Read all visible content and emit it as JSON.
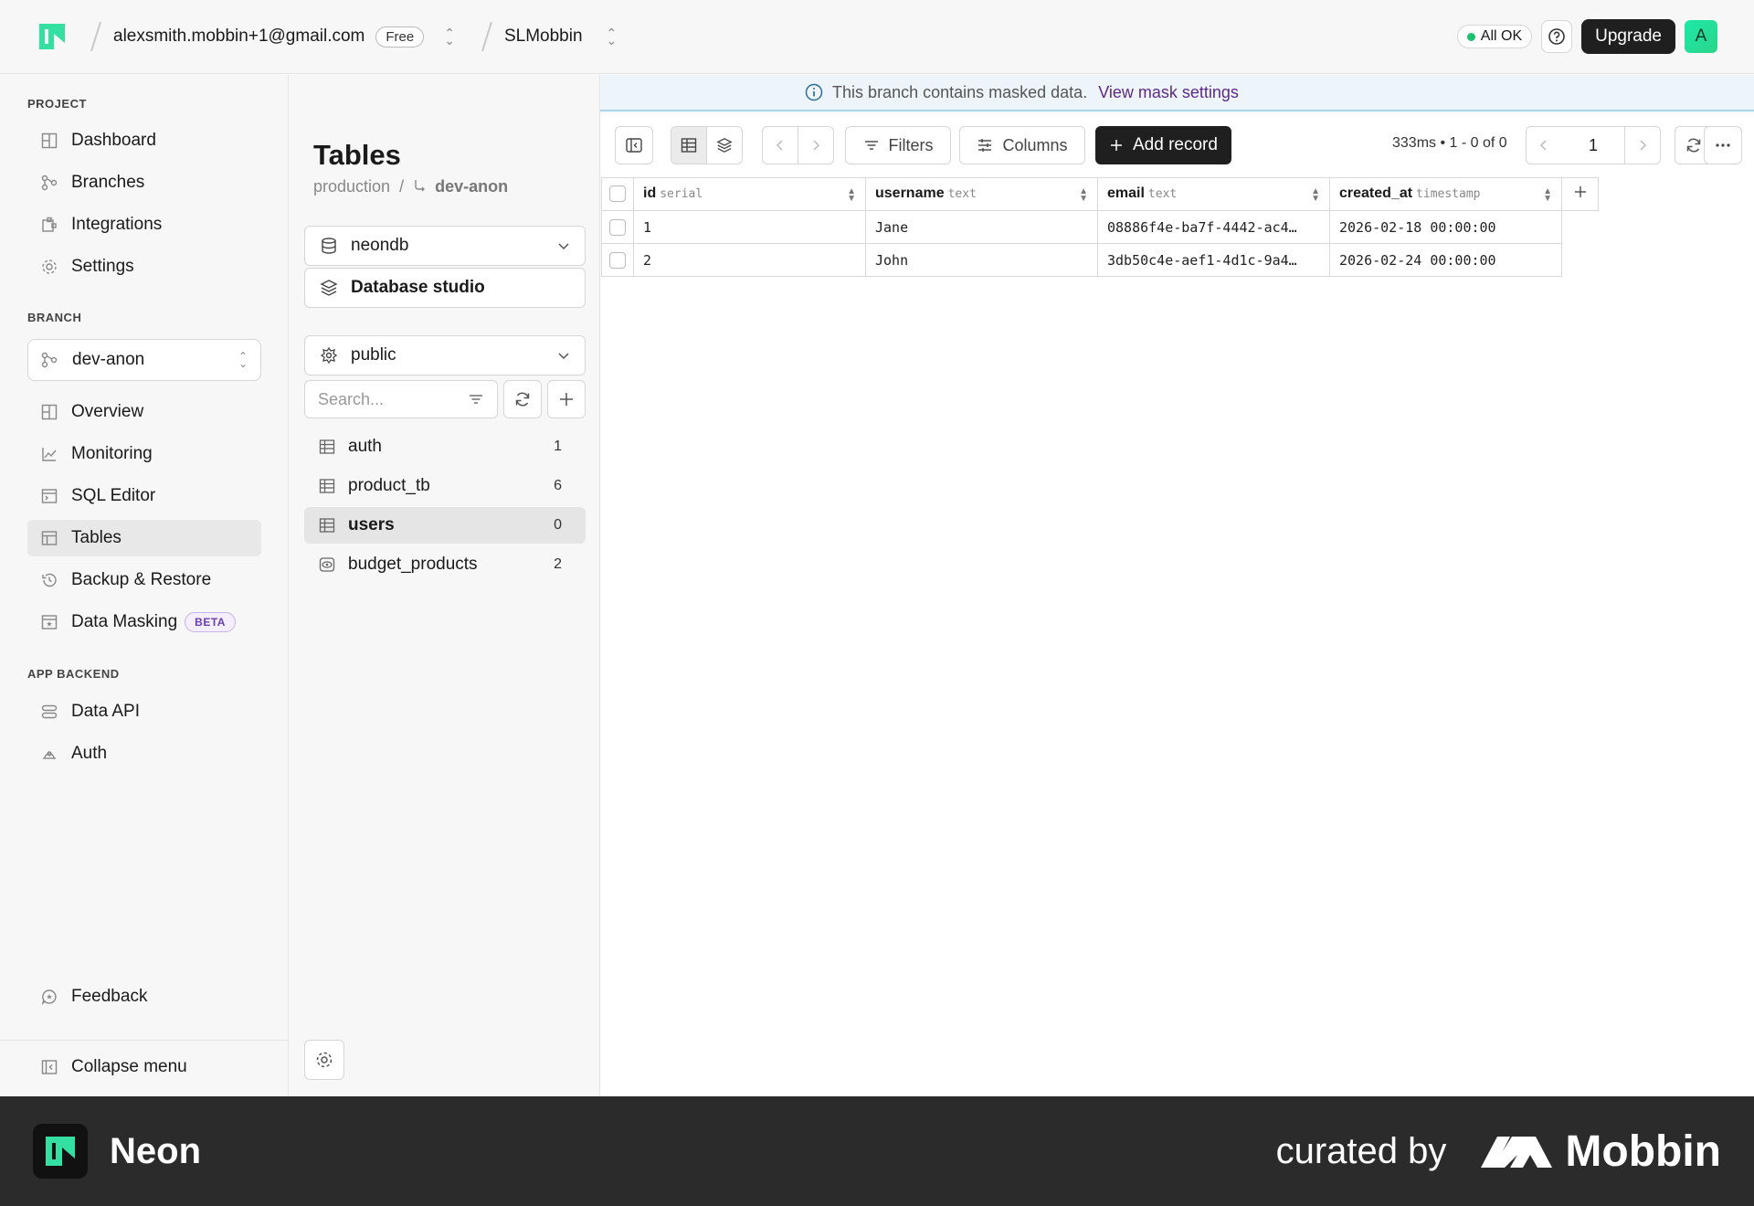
{
  "topbar": {
    "org_email": "alexsmith.mobbin+1@gmail.com",
    "plan_badge": "Free",
    "project_name": "SLMobbin",
    "status_label": "All OK",
    "upgrade_label": "Upgrade",
    "avatar_initial": "A"
  },
  "sidebar": {
    "project_section": "PROJECT",
    "project_items": [
      {
        "label": "Dashboard",
        "icon": "dashboard-icon"
      },
      {
        "label": "Branches",
        "icon": "branches-icon"
      },
      {
        "label": "Integrations",
        "icon": "integrations-icon"
      },
      {
        "label": "Settings",
        "icon": "gear-icon"
      }
    ],
    "branch_section": "BRANCH",
    "branch_selected": "dev-anon",
    "branch_items": [
      {
        "label": "Overview",
        "icon": "overview-icon"
      },
      {
        "label": "Monitoring",
        "icon": "monitoring-icon"
      },
      {
        "label": "SQL Editor",
        "icon": "sql-editor-icon"
      },
      {
        "label": "Tables",
        "icon": "tables-icon"
      },
      {
        "label": "Backup & Restore",
        "icon": "history-icon"
      },
      {
        "label": "Data Masking",
        "icon": "masking-icon",
        "badge": "BETA"
      }
    ],
    "app_backend_section": "APP BACKEND",
    "app_backend_items": [
      {
        "label": "Data API",
        "icon": "data-api-icon"
      },
      {
        "label": "Auth",
        "icon": "auth-icon"
      }
    ],
    "feedback_label": "Feedback",
    "collapse_label": "Collapse menu"
  },
  "banner": {
    "message": "This branch contains masked data.",
    "link_label": "View mask settings"
  },
  "tables_panel": {
    "title": "Tables",
    "breadcrumb_root": "production",
    "breadcrumb_sep": "/",
    "breadcrumb_branch": "dev-anon",
    "database": "neondb",
    "studio_label": "Database studio",
    "schema": "public",
    "search_placeholder": "Search...",
    "tables": [
      {
        "name": "auth",
        "count": "1"
      },
      {
        "name": "product_tb",
        "count": "6"
      },
      {
        "name": "users",
        "count": "0"
      },
      {
        "name": "budget_products",
        "count": "2"
      }
    ]
  },
  "toolbar": {
    "filters_label": "Filters",
    "columns_label": "Columns",
    "add_record_label": "Add record",
    "timing": "333ms • 1 - 0 of 0",
    "page": "1"
  },
  "grid": {
    "columns": [
      {
        "name": "id",
        "type": "serial"
      },
      {
        "name": "username",
        "type": "text"
      },
      {
        "name": "email",
        "type": "text"
      },
      {
        "name": "created_at",
        "type": "timestamp"
      }
    ],
    "rows": [
      [
        "1",
        "Jane",
        "08886f4e-ba7f-4442-ac4…",
        "2026-02-18 00:00:00"
      ],
      [
        "2",
        "John",
        "3db50c4e-aef1-4d1c-9a4…",
        "2026-02-24 00:00:00"
      ]
    ]
  },
  "footer": {
    "app_name": "Neon",
    "curated_by": "curated by",
    "brand": "Mobbin"
  },
  "colors": {
    "accent_green": "#1ec16b",
    "neon_logo": "#34e0a1",
    "mask_link": "#5b2a86",
    "dark_button": "#1f1f1f"
  }
}
